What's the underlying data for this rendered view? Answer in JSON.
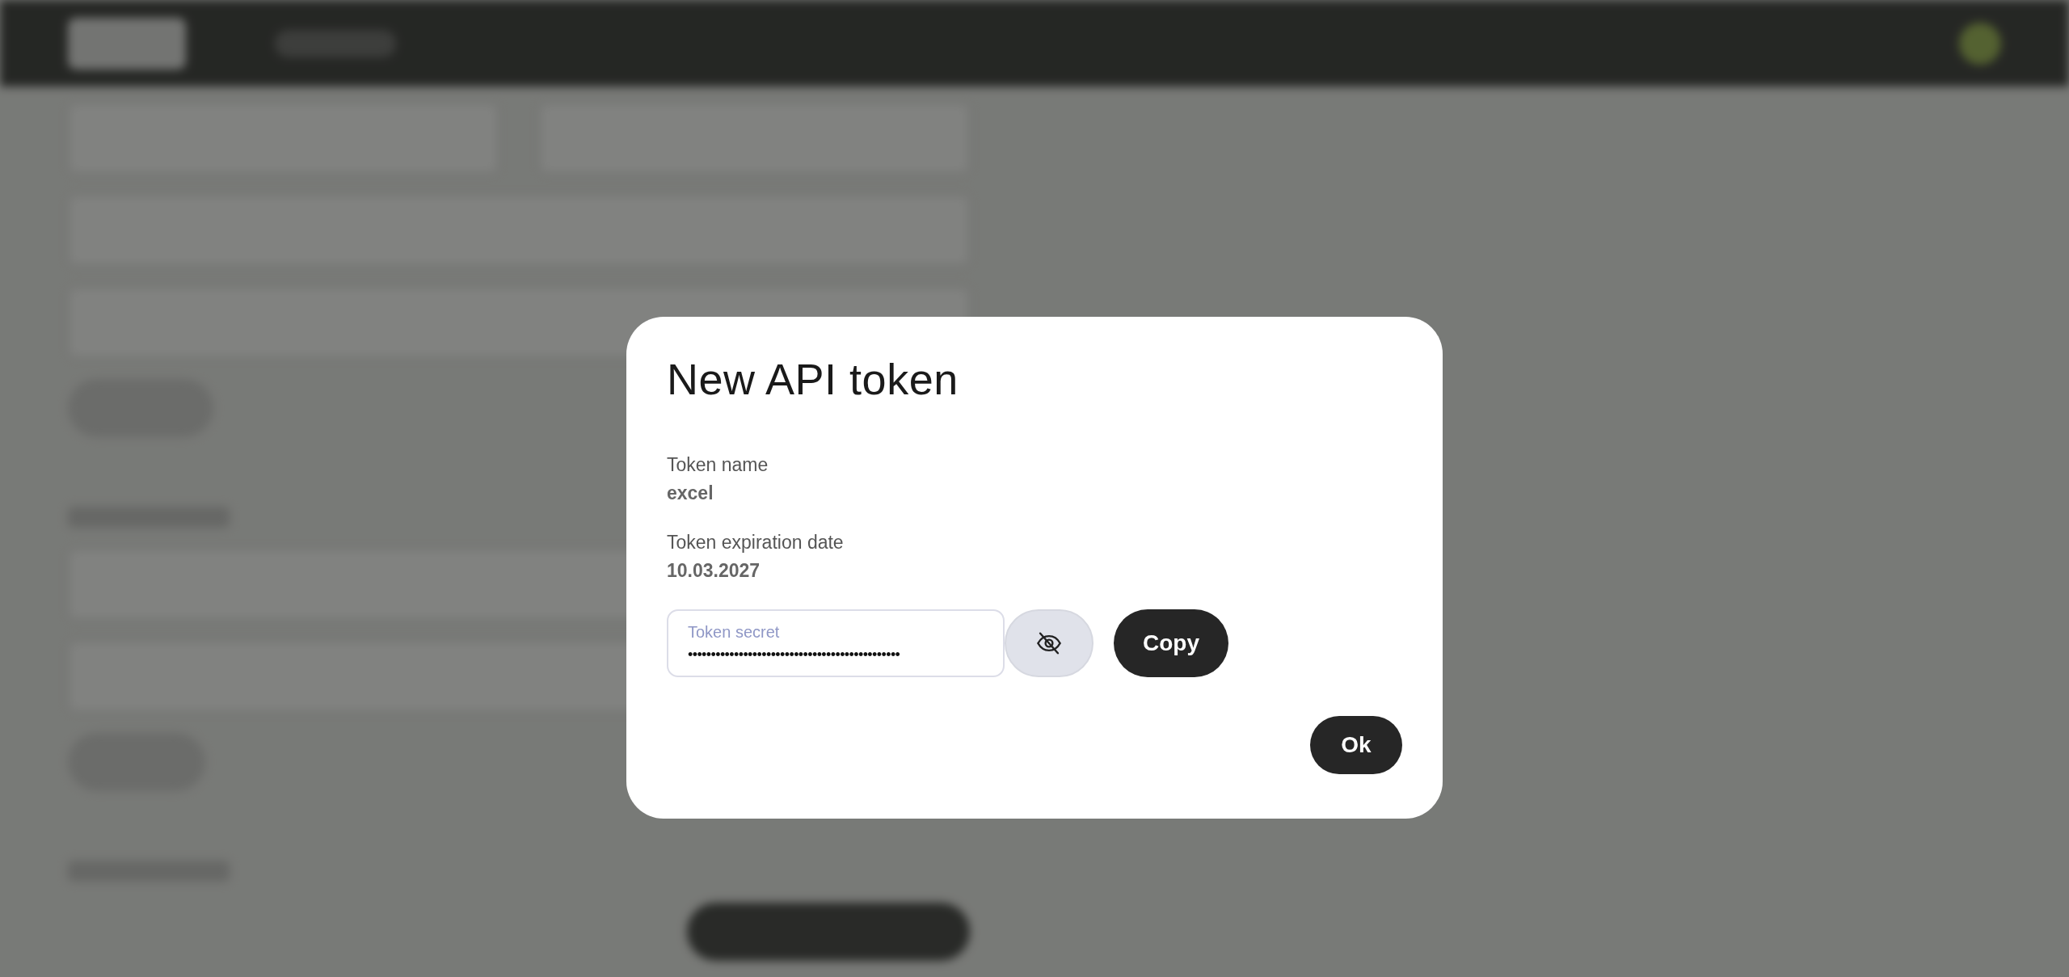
{
  "dialog": {
    "title": "New API token",
    "fields": [
      {
        "label": "Token name",
        "value": "excel"
      },
      {
        "label": "Token expiration date",
        "value": "10.03.2027"
      }
    ],
    "secret": {
      "label": "Token secret",
      "value": "••••••••••••••••••••••••••••••••••••••••••••••",
      "revealed": false
    },
    "copy_button": "Copy",
    "ok_button": "Ok"
  }
}
